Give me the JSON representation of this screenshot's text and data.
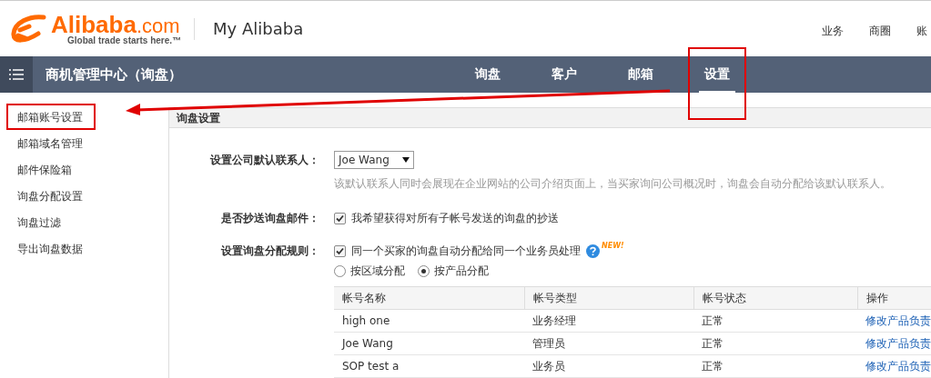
{
  "header": {
    "logo_text": "Alibaba",
    "logo_suffix": ".com",
    "logo_tagline": "Global trade starts here.™",
    "title": "My Alibaba",
    "top_links": [
      "业务",
      "商圈",
      "账"
    ]
  },
  "navbar": {
    "title": "商机管理中心（询盘）",
    "tabs": [
      {
        "label": "询盘",
        "selected": false,
        "highlighted": false
      },
      {
        "label": "客户",
        "selected": false,
        "highlighted": false
      },
      {
        "label": "邮箱",
        "selected": false,
        "highlighted": false
      },
      {
        "label": "设置",
        "selected": true,
        "highlighted": true
      }
    ]
  },
  "sidebar": {
    "items": [
      {
        "label": "邮箱账号设置",
        "highlighted": true
      },
      {
        "label": "邮箱域名管理",
        "highlighted": false
      },
      {
        "label": "邮件保险箱",
        "highlighted": false
      },
      {
        "label": "询盘分配设置",
        "highlighted": false
      },
      {
        "label": "询盘过滤",
        "highlighted": false
      },
      {
        "label": "导出询盘数据",
        "highlighted": false
      }
    ]
  },
  "section": {
    "title": "询盘设置",
    "default_contact": {
      "label": "设置公司默认联系人：",
      "value": "Joe Wang",
      "hint": "该默认联系人同时会展现在企业网站的公司介绍页面上，当买家询问公司概况时，询盘会自动分配给该默认联系人。"
    },
    "cc_mail": {
      "label": "是否抄送询盘邮件：",
      "option": "我希望获得对所有子帐号发送的询盘的抄送",
      "checked": true
    },
    "rule": {
      "label": "设置询盘分配规则：",
      "option": "同一个买家的询盘自动分配给同一个业务员处理",
      "checked": true,
      "badge": "NEW!",
      "radios": [
        {
          "label": "按区域分配",
          "selected": false
        },
        {
          "label": "按产品分配",
          "selected": true
        }
      ]
    },
    "table": {
      "columns": [
        "帐号名称",
        "帐号类型",
        "帐号状态",
        "操作"
      ],
      "rows": [
        {
          "name": "high one",
          "type": "业务经理",
          "status": "正常",
          "action": "修改产品负责"
        },
        {
          "name": "Joe Wang",
          "type": "管理员",
          "status": "正常",
          "action": "修改产品负责"
        },
        {
          "name": "SOP test a",
          "type": "业务员",
          "status": "正常",
          "action": "修改产品负责"
        }
      ]
    }
  }
}
